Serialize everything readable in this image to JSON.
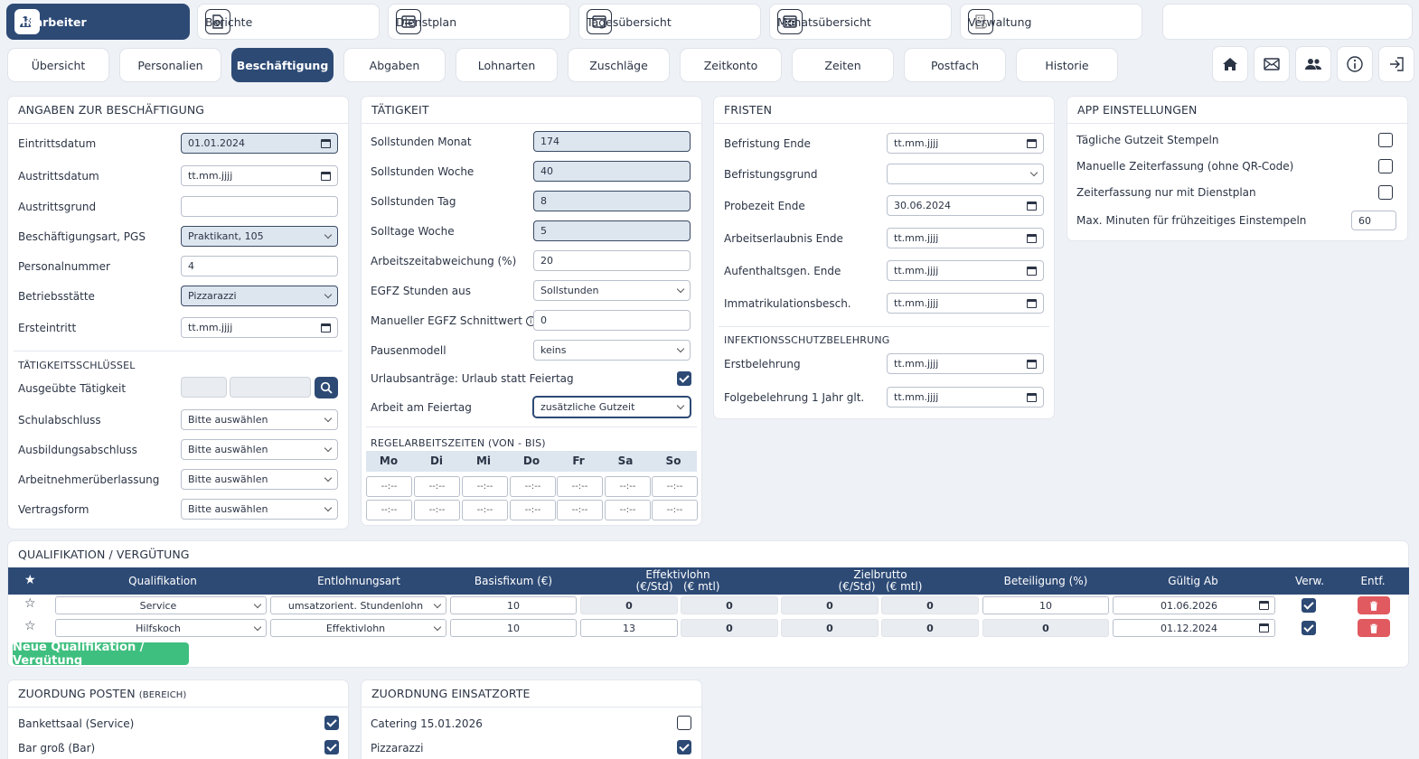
{
  "nav": [
    {
      "label": "Mitarbeiter",
      "icon": "user-plus-icon",
      "active": true
    },
    {
      "label": "Berichte",
      "icon": "report-icon"
    },
    {
      "label": "Dienstplan",
      "icon": "schedule-icon"
    },
    {
      "label": "Tagesübersicht",
      "icon": "day-view-icon"
    },
    {
      "label": "Monatsübersicht",
      "icon": "calendar-icon"
    },
    {
      "label": "Verwaltung",
      "icon": "building-icon"
    }
  ],
  "tabs": [
    "Übersicht",
    "Personalien",
    "Beschäftigung",
    "Abgaben",
    "Lohnarten",
    "Zuschläge",
    "Zeitkonto",
    "Zeiten",
    "Postfach",
    "Historie"
  ],
  "active_tab": "Beschäftigung",
  "top_icons": [
    "home-icon",
    "mail-icon",
    "users-icon",
    "info-icon",
    "logout-icon"
  ],
  "beschaeftigung": {
    "title": "ANGABEN ZUR BESCHÄFTIGUNG",
    "rows": [
      {
        "label": "Eintrittsdatum",
        "value": "01.01.2024"
      },
      {
        "label": "Austrittsdatum",
        "value": "tt.mm.jjjj"
      },
      {
        "label": "Austrittsgrund",
        "value": ""
      },
      {
        "label": "Beschäftigungsart, PGS",
        "value": "Praktikant, 105"
      },
      {
        "label": "Personalnummer",
        "value": "4"
      },
      {
        "label": "Betriebsstätte",
        "value": "Pizzarazzi"
      },
      {
        "label": "Ersteintritt",
        "value": "tt.mm.jjjj"
      }
    ],
    "key_title": "TÄTIGKEITSSCHLÜSSEL",
    "key_rows": [
      {
        "label": "Ausgeübte Tätigkeit",
        "value": ""
      },
      {
        "label": "Schulabschluss",
        "value": "Bitte auswählen"
      },
      {
        "label": "Ausbildungsabschluss",
        "value": "Bitte auswählen"
      },
      {
        "label": "Arbeitnehmerüberlassung",
        "value": "Bitte auswählen"
      },
      {
        "label": "Vertragsform",
        "value": "Bitte auswählen"
      }
    ]
  },
  "taetigkeit": {
    "title": "TÄTIGKEIT",
    "rows": [
      {
        "label": "Sollstunden Monat",
        "value": "174"
      },
      {
        "label": "Sollstunden Woche",
        "value": "40"
      },
      {
        "label": "Sollstunden Tag",
        "value": "8"
      },
      {
        "label": "Solltage Woche",
        "value": "5"
      },
      {
        "label": "Arbeitszeitabweichung (%)",
        "value": "20"
      },
      {
        "label": "EGFZ Stunden aus",
        "value": "Sollstunden"
      },
      {
        "label": "Manueller EGFZ Schnittwert",
        "value": "0"
      },
      {
        "label": "Pausenmodell",
        "value": "keins"
      },
      {
        "label": "Urlaubsanträge: Urlaub statt Feiertag",
        "checked": true
      },
      {
        "label": "Arbeit am Feiertag",
        "value": "zusätzliche Gutzeit"
      }
    ],
    "regel_title": "REGELARBEITSZEITEN",
    "regel_sub": "(VON - BIS)",
    "days": [
      "Mo",
      "Di",
      "Mi",
      "Do",
      "Fr",
      "Sa",
      "So"
    ],
    "time_placeholder": "--:--"
  },
  "fristen": {
    "title": "FRISTEN",
    "rows": [
      {
        "label": "Befristung Ende",
        "value": "tt.mm.jjjj"
      },
      {
        "label": "Befristungsgrund",
        "value": ""
      },
      {
        "label": "Probezeit Ende",
        "value": "30.06.2024"
      },
      {
        "label": "Arbeitserlaubnis Ende",
        "value": "tt.mm.jjjj"
      },
      {
        "label": "Aufenthaltsgen. Ende",
        "value": "tt.mm.jjjj"
      },
      {
        "label": "Immatrikulationsbesch.",
        "value": "tt.mm.jjjj"
      }
    ],
    "infektion_title": "INFEKTIONSSCHUTZBELEHRUNG",
    "infektion_rows": [
      {
        "label": "Erstbelehrung",
        "value": "tt.mm.jjjj"
      },
      {
        "label": "Folgebelehrung 1 Jahr glt.",
        "value": "tt.mm.jjjj"
      }
    ]
  },
  "app": {
    "title": "APP EINSTELLUNGEN",
    "rows": [
      {
        "label": "Tägliche Gutzeit Stempeln",
        "checked": false
      },
      {
        "label": "Manuelle Zeiterfassung (ohne QR-Code)",
        "checked": false
      },
      {
        "label": "Zeiterfassung nur mit Dienstplan",
        "checked": false
      },
      {
        "label": "Max. Minuten für frühzeitiges Einstempeln",
        "value": "60"
      }
    ]
  },
  "quali": {
    "title": "QUALIFIKATION / VERGÜTUNG",
    "headers": {
      "qualifikation": "Qualifikation",
      "entlohnungsart": "Entlohnungsart",
      "basisfixum": "Basisfixum (€)",
      "effektivlohn": "Effektivlohn",
      "effektivlohn_sub": "(€/Std)   (€ mtl)",
      "zielbrutto": "Zielbrutto",
      "zielbrutto_sub": "(€/Std)   (€ mtl)",
      "beteiligung": "Beteiligung (%)",
      "gueltig": "Gültig Ab",
      "verw": "Verw.",
      "entf": "Entf."
    },
    "rows": [
      {
        "qualifikation": "Service",
        "entlohnungsart": "umsatzorient. Stundenlohn",
        "basisfixum": "10",
        "eff_std": "0",
        "eff_mtl": "0",
        "ziel_std": "0",
        "ziel_mtl": "0",
        "beteiligung": "10",
        "gueltig": "01.06.2026",
        "verw": true
      },
      {
        "qualifikation": "Hilfskoch",
        "entlohnungsart": "Effektivlohn",
        "basisfixum": "10",
        "eff_std": "13",
        "eff_mtl": "0",
        "ziel_std": "0",
        "ziel_mtl": "0",
        "beteiligung": "0",
        "gueltig": "01.12.2024",
        "verw": true
      }
    ],
    "new_button": "Neue Qualifikation / Vergütung"
  },
  "posten": {
    "title": "ZUORDUNG POSTEN",
    "title_sub": "(BEREICH)",
    "rows": [
      {
        "label": "Bankettsaal (Service)",
        "checked": true
      },
      {
        "label": "Bar groß (Bar)",
        "checked": true
      }
    ]
  },
  "einsatzorte": {
    "title": "ZUORDNUNG EINSATZORTE",
    "rows": [
      {
        "label": "Catering 15.01.2026",
        "checked": false
      },
      {
        "label": "Pizzarazzi",
        "checked": true
      }
    ]
  }
}
